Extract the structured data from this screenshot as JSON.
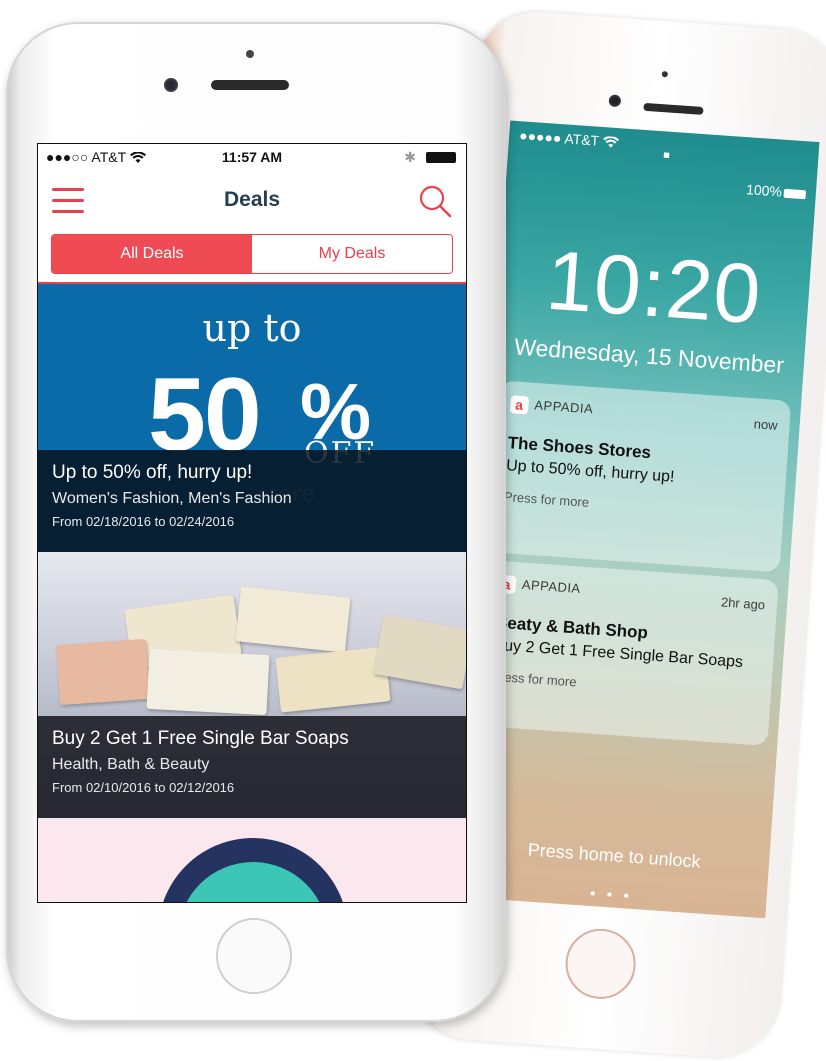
{
  "left_phone": {
    "status": {
      "carrier": "●●●○○ AT&T",
      "time": "11:57 AM",
      "bluetooth": "✱"
    },
    "nav": {
      "title": "Deals"
    },
    "segments": [
      {
        "label": "All Deals"
      },
      {
        "label": "My Deals"
      }
    ],
    "ad1": {
      "upto": "up to",
      "percent": "50",
      "percent_sign": "%",
      "off": "OFF",
      "store": "store"
    },
    "deals": [
      {
        "title": "Up to 50% off, hurry up!",
        "category": "Women's Fashion, Men's Fashion",
        "dates": "From 02/18/2016 to 02/24/2016"
      },
      {
        "title": "Buy 2 Get 1 Free Single Bar Soaps",
        "category": "Health, Bath & Beauty",
        "dates": "From 02/10/2016 to 02/12/2016"
      }
    ]
  },
  "right_phone": {
    "status": {
      "carrier": "●●●●● AT&T",
      "battery": "100%"
    },
    "time": "10:20",
    "date": "Wednesday, 15 November",
    "notifications": [
      {
        "app": "APPADIA",
        "when": "now",
        "title": "The Shoes Stores",
        "body": "Up to 50% off, hurry up!",
        "more": "Press for more"
      },
      {
        "app": "APPADIA",
        "when": "2hr ago",
        "title": "Beaty & Bath Shop",
        "body": "Buy 2 Get 1 Free Single Bar Soaps",
        "more": "Press for more"
      }
    ],
    "unlock": "Press home to unlock"
  },
  "colors": {
    "accent": "#e8414b",
    "nav_title": "#263f4e",
    "ad_blue": "#0b6aa8"
  },
  "icons": [
    "menu-icon",
    "search-icon",
    "wifi-icon",
    "bluetooth-icon",
    "battery-icon",
    "lock-icon",
    "appadia-icon",
    "camera-icon"
  ]
}
